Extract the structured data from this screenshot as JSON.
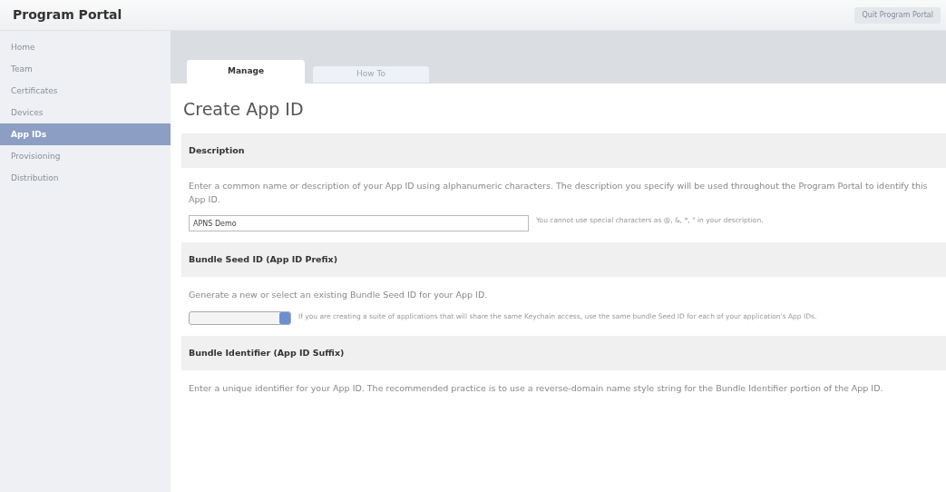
{
  "header": {
    "title": "Program Portal",
    "quit_button": "Quit Program Portal"
  },
  "sidebar": {
    "items": [
      {
        "label": "Home",
        "selected": false
      },
      {
        "label": "Team",
        "selected": false
      },
      {
        "label": "Certificates",
        "selected": false
      },
      {
        "label": "Devices",
        "selected": false
      },
      {
        "label": "App IDs",
        "selected": true
      },
      {
        "label": "Provisioning",
        "selected": false
      },
      {
        "label": "Distribution",
        "selected": false
      }
    ]
  },
  "tabs": [
    {
      "label": "Manage",
      "selected": true
    },
    {
      "label": "How To",
      "selected": false
    }
  ],
  "page_title": "Create App ID",
  "sections": [
    {
      "heading": "Description",
      "text": "Enter a common name or description of your App ID using alphanumeric characters. The description you specify will be used throughout the Program Portal to identify this App ID.",
      "kind": "input",
      "value": "APNS Demo",
      "hint": "You cannot use special characters as @, &, *, \" in your description."
    },
    {
      "heading": "Bundle Seed ID (App ID Prefix)",
      "text": "Generate a new or select an existing Bundle Seed ID for your App ID.",
      "kind": "select",
      "hint": "If you are creating a suite of applications that will share the same Keychain access, use the same bundle Seed ID for each of your application's App IDs."
    },
    {
      "heading": "Bundle Identifier (App ID Suffix)",
      "text": "Enter a unique identifier for your App ID. The recommended practice is to use a reverse-domain name style string for the Bundle Identifier portion of the App ID.",
      "kind": "none"
    }
  ]
}
